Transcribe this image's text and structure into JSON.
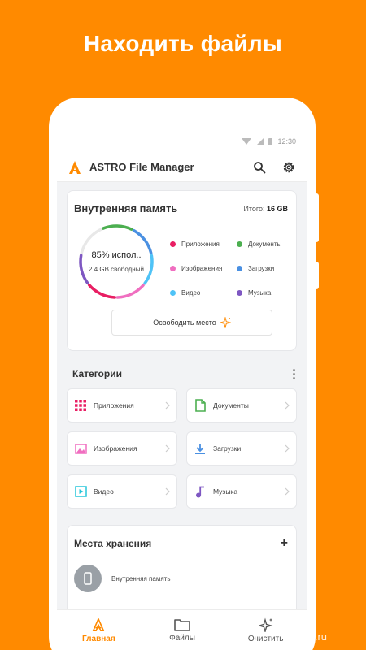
{
  "promo": {
    "title": "Находить файлы"
  },
  "status_bar": {
    "time": "12:30"
  },
  "app": {
    "title": "ASTRO File Manager",
    "accent": "#FF8A00"
  },
  "storage": {
    "title": "Внутренняя память",
    "total_label": "Итого:",
    "total_value": "16 GB",
    "used_text": "85% испол..",
    "free_text": "2.4 GB свободный",
    "used_fraction": 0.85,
    "legend": [
      {
        "label": "Приложения",
        "color": "#E91E63"
      },
      {
        "label": "Документы",
        "color": "#4CAF50"
      },
      {
        "label": "Изображения",
        "color": "#F06EC0"
      },
      {
        "label": "Загрузки",
        "color": "#4A90E2"
      },
      {
        "label": "Видео",
        "color": "#4FC3F7"
      },
      {
        "label": "Музыка",
        "color": "#7E57C2"
      }
    ],
    "free_button": "Освободить место"
  },
  "categories": {
    "title": "Категории",
    "items": [
      {
        "label": "Приложения",
        "icon": "apps-grid-icon",
        "color": "#E91E63"
      },
      {
        "label": "Документы",
        "icon": "document-icon",
        "color": "#4CAF50"
      },
      {
        "label": "Изображения",
        "icon": "image-icon",
        "color": "#F06EC0"
      },
      {
        "label": "Загрузки",
        "icon": "download-icon",
        "color": "#4A90E2"
      },
      {
        "label": "Видео",
        "icon": "video-icon",
        "color": "#26C6DA"
      },
      {
        "label": "Музыка",
        "icon": "music-icon",
        "color": "#7E57C2"
      }
    ]
  },
  "places": {
    "title": "Места хранения",
    "add": "+",
    "items": [
      {
        "label": "Внутренняя память",
        "icon": "phone-icon"
      }
    ]
  },
  "bottom_nav": [
    {
      "label": "Главная",
      "icon": "astro-logo-icon",
      "active": true
    },
    {
      "label": "Файлы",
      "icon": "folder-icon",
      "active": false
    },
    {
      "label": "Очистить",
      "icon": "sparkle-icon",
      "active": false
    }
  ],
  "watermark": "klad.ru"
}
